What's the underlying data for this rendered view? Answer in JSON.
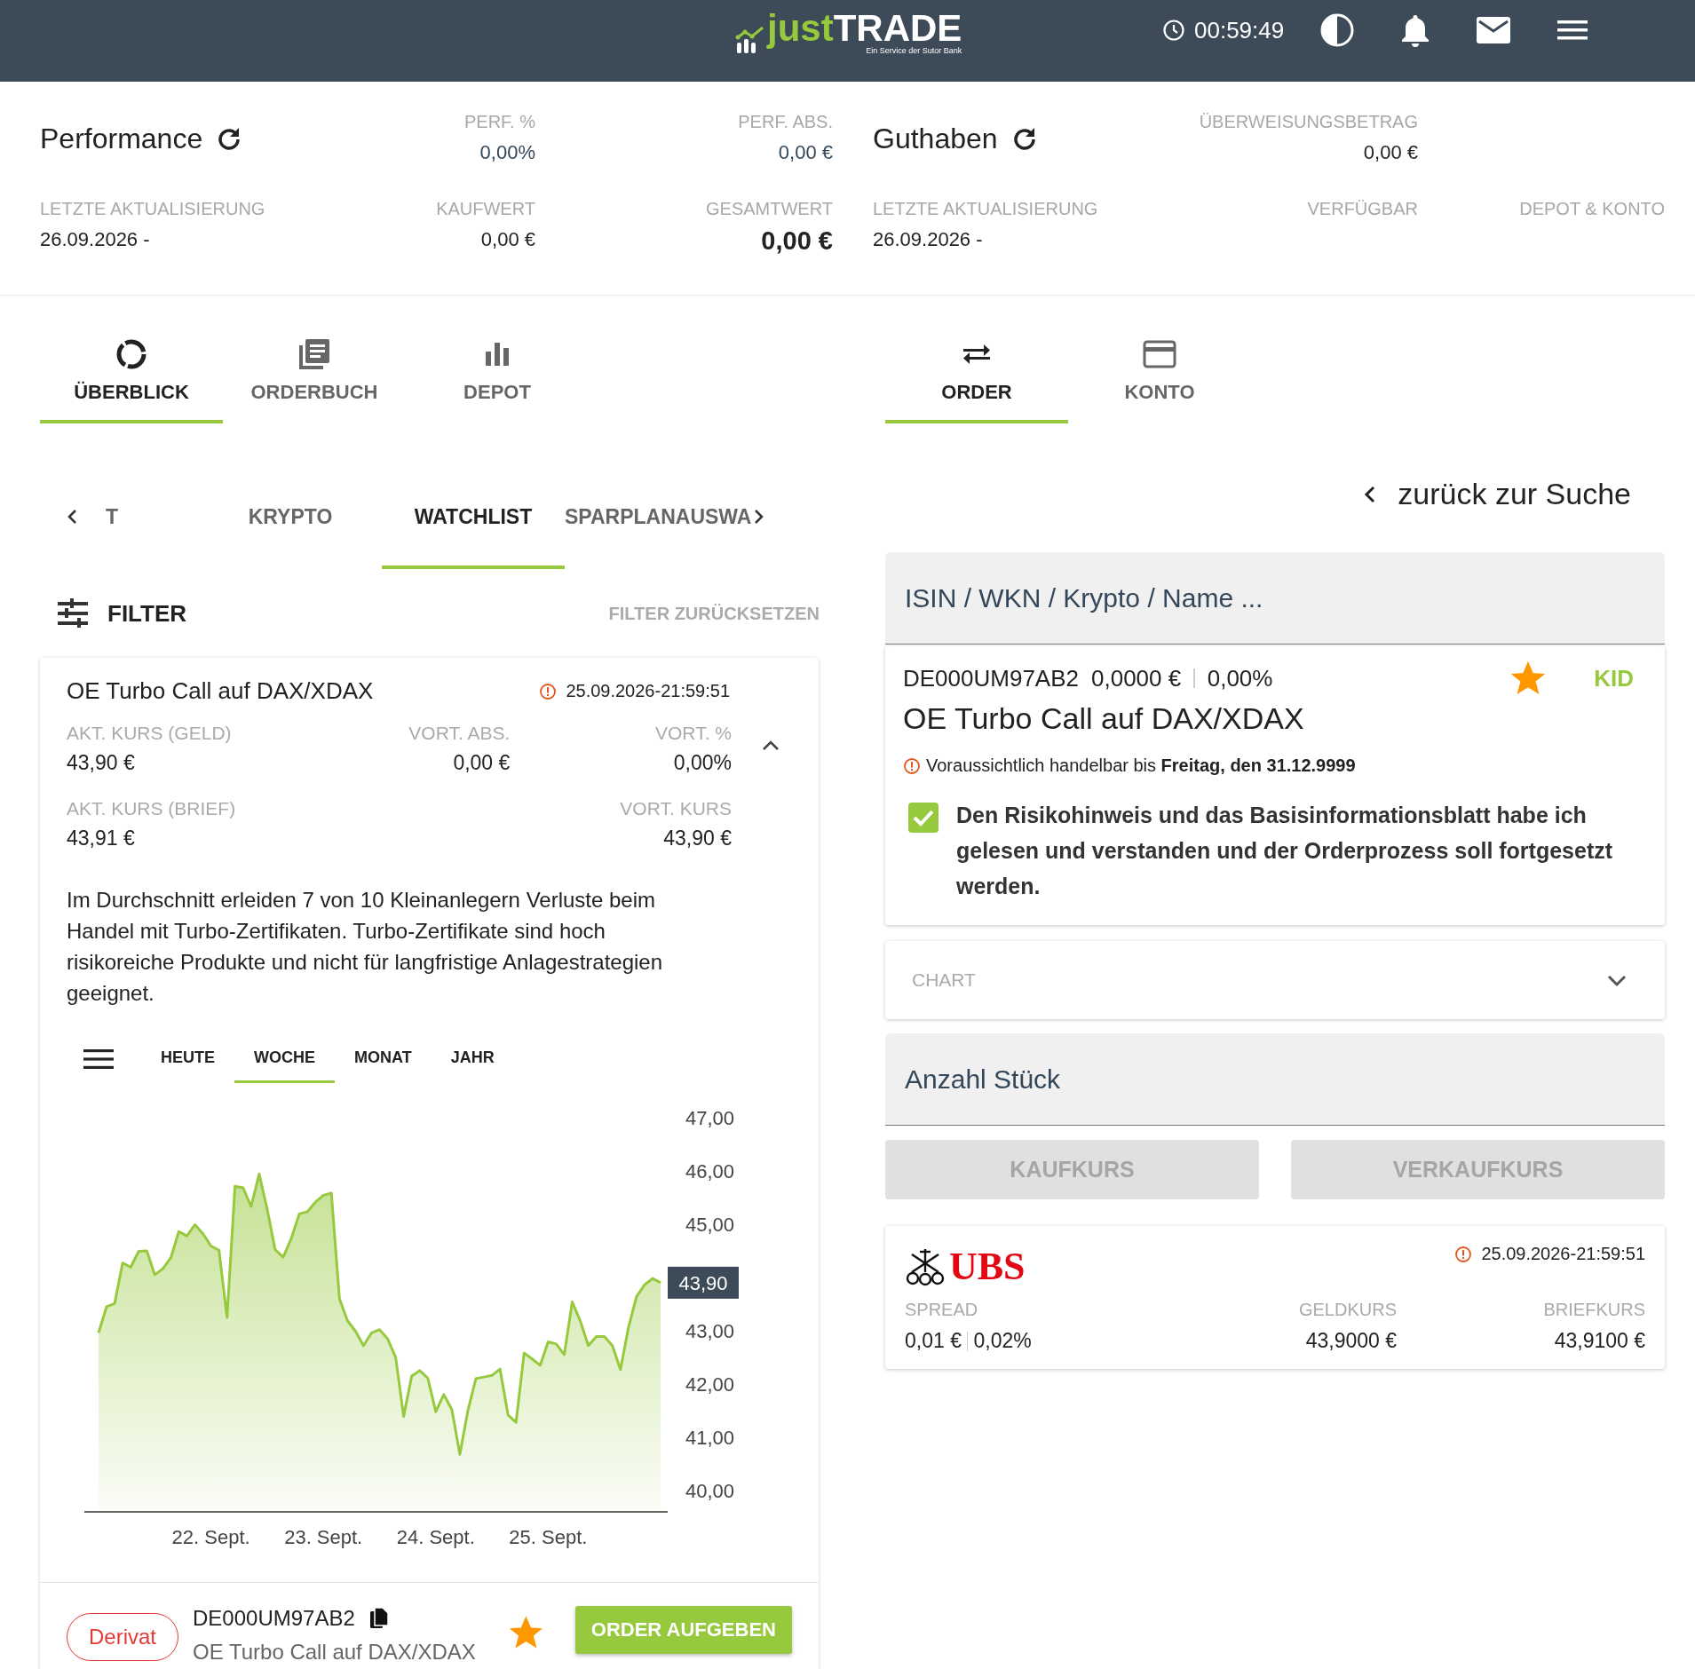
{
  "header": {
    "brand_prefix": "just",
    "brand_suffix": "TRADE",
    "tagline": "Ein Service der Sutor Bank",
    "timer": "00:59:49"
  },
  "performance": {
    "title": "Performance",
    "updated": {
      "label": "LETZTE AKTUALISIERUNG",
      "value": "26.09.2026 -"
    },
    "stats": [
      {
        "label": "PERF. %",
        "value": "0,00%",
        "kind": "normal"
      },
      {
        "label": "PERF. ABS.",
        "value": "0,00 €",
        "kind": "normal"
      },
      {
        "label": "KAUFWERT",
        "value": "0,00 €",
        "kind": "normal"
      },
      {
        "label": "GESAMTWERT",
        "value": "0,00 €",
        "kind": "total"
      }
    ]
  },
  "balance": {
    "title": "Guthaben",
    "updated": {
      "label": "LETZTE AKTUALISIERUNG",
      "value": "26.09.2026 -"
    },
    "stats": [
      {
        "label": "ÜBERWEISUNGSBETRAG",
        "value": "0,00 €"
      },
      {
        "label": "VERFÜGBAR"
      },
      {
        "label": "DEPOT & KONTO"
      }
    ]
  },
  "main_tabs_left": [
    {
      "label": "ÜBERBLICK",
      "selected": true
    },
    {
      "label": "ORDERBUCH",
      "selected": false
    },
    {
      "label": "DEPOT",
      "selected": false
    }
  ],
  "main_tabs_right": [
    {
      "label": "ORDER",
      "selected": true
    },
    {
      "label": "KONTO",
      "selected": false
    }
  ],
  "sub_tabs": [
    {
      "label": "T",
      "selected": false
    },
    {
      "label": "KRYPTO",
      "selected": false
    },
    {
      "label": "WATCHLIST",
      "selected": true
    },
    {
      "label": "SPARPLANAUSWA",
      "selected": false
    }
  ],
  "filter": {
    "label": "FILTER",
    "reset": "FILTER ZURÜCKSETZEN"
  },
  "watch_card": {
    "title": "OE Turbo Call auf DAX/XDAX",
    "timestamp": "25.09.2026-21:59:51",
    "expanded": true,
    "stats": [
      {
        "label": "AKT. KURS (GELD)",
        "value": "43,90 €"
      },
      {
        "label": "VORT. ABS.",
        "value": "0,00 €"
      },
      {
        "label": "VORT. %",
        "value": "0,00%"
      },
      {
        "label": "AKT. KURS (BRIEF)",
        "value": "43,91 €"
      },
      {
        "label": "VORT. KURS",
        "value": "43,90 €"
      }
    ],
    "disclaimer": "Im Durchschnitt erleiden 7 von 10 Kleinanlegern Verluste beim Handel mit Turbo-Zertifikaten. Turbo-Zertifikate sind hoch risikoreiche Produkte und nicht für langfristige Anlagestrategien geeignet.",
    "ranges": [
      {
        "label": "HEUTE",
        "selected": false
      },
      {
        "label": "WOCHE",
        "selected": true
      },
      {
        "label": "MONAT",
        "selected": false
      },
      {
        "label": "JAHR",
        "selected": false
      }
    ],
    "chart_data": {
      "type": "area",
      "ylim": [
        39.62,
        47
      ],
      "yticks": [
        {
          "value": 40,
          "label": "40,00"
        },
        {
          "value": 41,
          "label": "41,00"
        },
        {
          "value": 42,
          "label": "42,00"
        },
        {
          "value": 43,
          "label": "43,00"
        },
        {
          "value": 45,
          "label": "45,00"
        },
        {
          "value": 46,
          "label": "46,00"
        },
        {
          "value": 47,
          "label": "47,00"
        }
      ],
      "annotations": [
        "43,90"
      ],
      "categories": [
        null,
        null,
        null,
        null,
        null,
        null,
        null,
        null,
        null,
        null,
        null,
        null,
        null,
        null,
        "22. Sept.",
        null,
        null,
        null,
        null,
        null,
        null,
        null,
        null,
        null,
        null,
        null,
        null,
        null,
        "23. Sept.",
        null,
        null,
        null,
        null,
        null,
        null,
        null,
        null,
        null,
        null,
        null,
        null,
        null,
        "24. Sept.",
        null,
        null,
        null,
        null,
        null,
        null,
        null,
        null,
        null,
        null,
        null,
        null,
        null,
        "25. Sept.",
        null,
        null,
        null,
        null,
        null,
        null,
        null,
        null,
        null,
        null,
        null,
        null,
        null,
        null
      ],
      "series": [
        {
          "color": "#96c93d",
          "values": [
            42.98,
            43.47,
            43.53,
            44.29,
            44.21,
            44.51,
            44.52,
            44.07,
            44.18,
            44.39,
            44.88,
            44.8,
            45.01,
            44.84,
            44.61,
            44.53,
            43.27,
            45.73,
            45.7,
            45.35,
            45.96,
            45.3,
            44.54,
            44.4,
            44.75,
            45.21,
            45.25,
            45.43,
            45.56,
            45.6,
            43.62,
            43.21,
            43.01,
            42.74,
            42.98,
            43.04,
            42.87,
            42.52,
            41.41,
            42.17,
            42.27,
            42.13,
            41.5,
            41.82,
            41.54,
            40.7,
            41.52,
            42.12,
            42.15,
            42.18,
            42.3,
            41.44,
            41.3,
            42.6,
            42.49,
            42.37,
            42.81,
            42.77,
            42.57,
            43.56,
            43.2,
            42.74,
            42.91,
            42.91,
            42.74,
            42.29,
            43.08,
            43.66,
            43.88,
            44.0,
            43.92
          ]
        }
      ]
    },
    "footer": {
      "tag": "Derivat",
      "isin": "DE000UM97AB2",
      "name": "OE Turbo Call auf DAX/XDAX",
      "favorite": true,
      "button": "ORDER AUFGEBEN"
    }
  },
  "back_link": "zurück zur Suche",
  "search": {
    "placeholder": "ISIN / WKN / Krypto / Name ..."
  },
  "product": {
    "isin": "DE000UM97AB2",
    "price": "0,0000 €",
    "change": "0,00%",
    "favorite": true,
    "kid": "KID",
    "name": "OE Turbo Call auf DAX/XDAX",
    "notice": "Voraussichtlich handelbar bis **Freitag, den 31.12.9999**",
    "consent": {
      "checked": true,
      "text": "Den Risikohinweis und das Basisinformationsblatt habe ich gelesen und verstanden und der Orderprozess soll fortgesetzt werden."
    }
  },
  "chart_panel": {
    "label": "CHART",
    "expanded": false
  },
  "quantity": {
    "placeholder": "Anzahl Stück"
  },
  "price_buttons": [
    {
      "label": "KAUFKURS",
      "disabled": true
    },
    {
      "label": "VERKAUFKURS",
      "disabled": true
    }
  ],
  "quote": {
    "issuer": "UBS",
    "timestamp": "25.09.2026-21:59:51",
    "stats": [
      {
        "label": "SPREAD",
        "values": [
          "0,01 €",
          "0,02%"
        ]
      },
      {
        "label": "GELDKURS",
        "values": [
          "43,9000 €"
        ]
      },
      {
        "label": "BRIEFKURS",
        "values": [
          "43,9100 €"
        ]
      }
    ]
  }
}
